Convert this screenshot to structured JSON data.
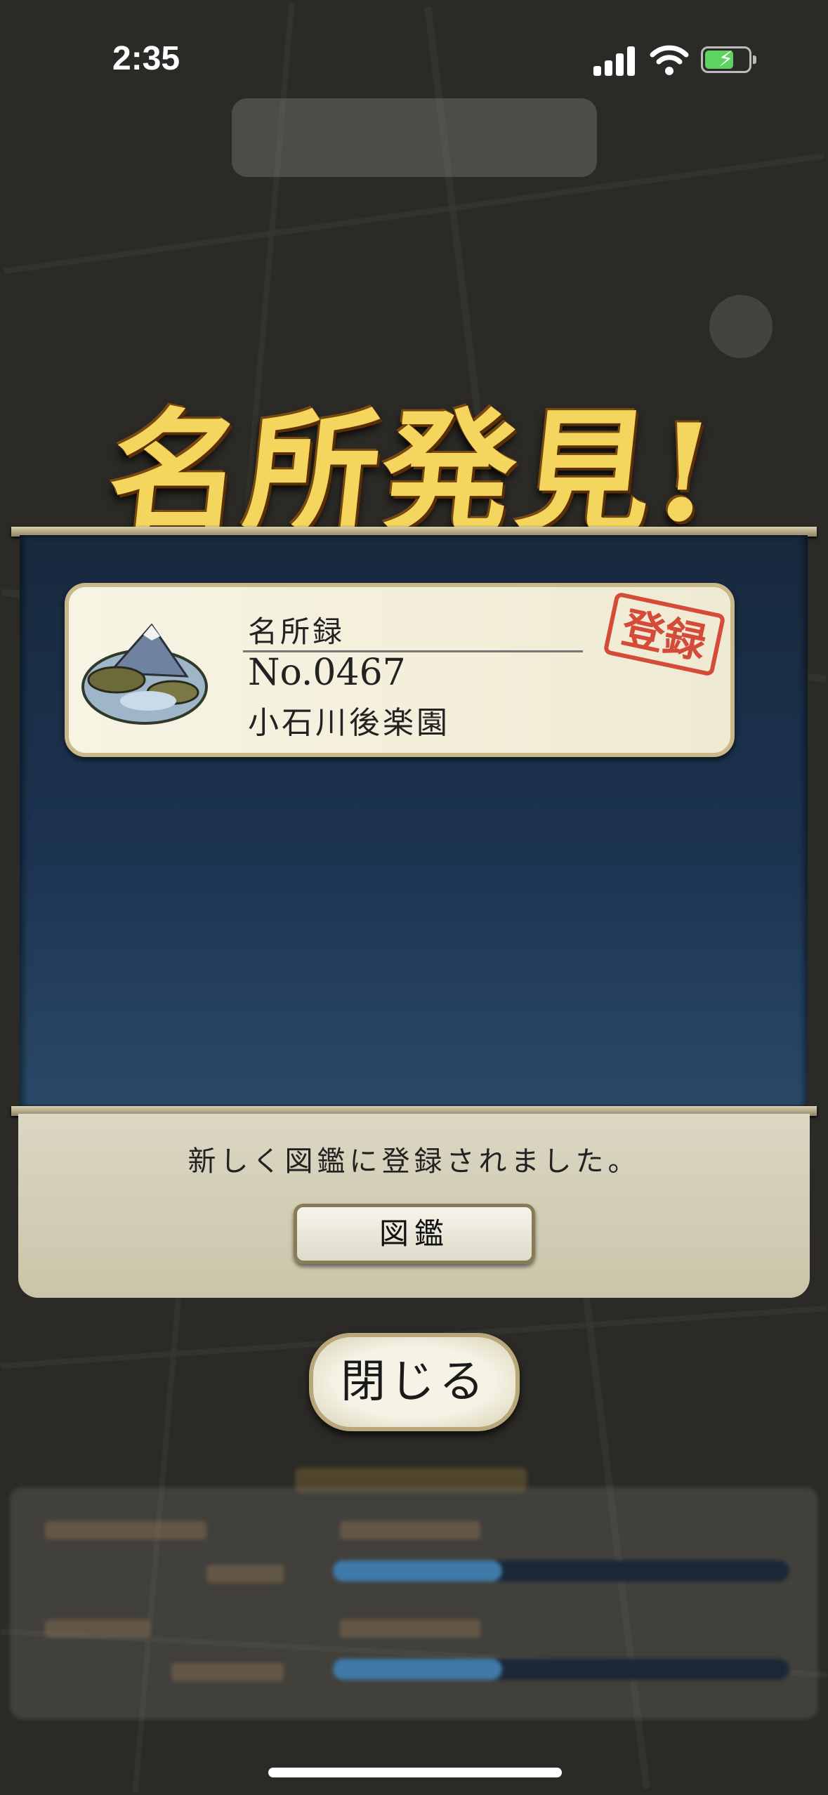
{
  "status_bar": {
    "time": "2:35"
  },
  "dialog": {
    "title": "名所発見!",
    "card": {
      "label": "名所録",
      "number": "No.0467",
      "name": "小石川後楽園",
      "stamp": "登録"
    },
    "message": "新しく図鑑に登録されました。",
    "zukan_button": "図鑑"
  },
  "close_button": "閉じる",
  "icons": [
    "signal-icon",
    "wifi-icon",
    "battery-charging-icon",
    "mountain-landscape-icon",
    "registered-stamp-icon"
  ]
}
